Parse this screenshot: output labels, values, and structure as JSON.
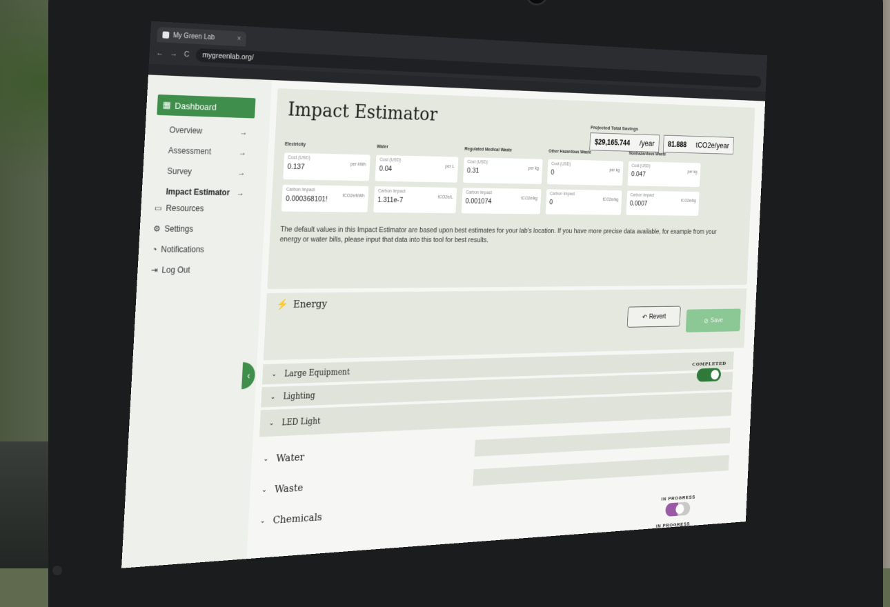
{
  "browser": {
    "tab_title": "My Green Lab",
    "tab_close": "×",
    "url": "mygreenlab.org/",
    "nav_back": "←",
    "nav_forward": "→",
    "nav_reload": "C"
  },
  "sidebar": {
    "dashboard": "Dashboard",
    "items": [
      {
        "label": "Overview",
        "arrow": "→"
      },
      {
        "label": "Assessment",
        "arrow": "→"
      },
      {
        "label": "Survey",
        "arrow": "→"
      },
      {
        "label": "Impact Estimator",
        "arrow": "→"
      }
    ],
    "resources": "Resources",
    "settings": "Settings",
    "notifications": "Notifications",
    "logout": "Log Out",
    "collapse": "‹"
  },
  "estimator": {
    "title": "Impact Estimator",
    "projected_label": "Projected Total Savings",
    "cost_value": "$29,165.744",
    "cost_unit": "/year",
    "carbon_value": "81.888",
    "carbon_unit": "tCO2e/year",
    "categories": [
      {
        "name": "Electricity",
        "cost_label": "Cost (USD)",
        "cost": "0.137",
        "cost_unit": "per kWh",
        "carbon_label": "Carbon Impact",
        "carbon": "0.000368101!",
        "carbon_unit": "tCO2e/kWh"
      },
      {
        "name": "Water",
        "cost_label": "Cost (USD)",
        "cost": "0.04",
        "cost_unit": "per L",
        "carbon_label": "Carbon Impact",
        "carbon": "1.311e-7",
        "carbon_unit": "tCO2e/L"
      },
      {
        "name": "Regulated Medical Waste",
        "cost_label": "Cost (USD)",
        "cost": "0.31",
        "cost_unit": "per kg",
        "carbon_label": "Carbon Impact",
        "carbon": "0.001074",
        "carbon_unit": "tCO2e/kg"
      },
      {
        "name": "Other Hazardous Waste",
        "cost_label": "Cost (USD)",
        "cost": "0",
        "cost_unit": "per kg",
        "carbon_label": "Carbon Impact",
        "carbon": "0",
        "carbon_unit": "tCO2e/kg"
      },
      {
        "name": "Nonhazardous Waste",
        "cost_label": "Cost (USD)",
        "cost": "0.047",
        "cost_unit": "per kg",
        "carbon_label": "Carbon Impact",
        "carbon": "0.0007",
        "carbon_unit": "tCO2e/kg"
      }
    ],
    "note": "The default values in this Impact Estimator are based upon best estimates for your lab's location. If you have more precise data available, for example from your energy or water bills, please input that data into this tool for best results."
  },
  "energy": {
    "title": "Energy",
    "revert": "Revert",
    "save": "Save",
    "rows": [
      "Large Equipment",
      "Lighting",
      "LED Light"
    ],
    "status": "COMPLETED"
  },
  "sections": [
    "Water",
    "Waste",
    "Chemicals"
  ],
  "statuses": [
    "IN PROGRESS",
    "IN PROGRESS"
  ]
}
